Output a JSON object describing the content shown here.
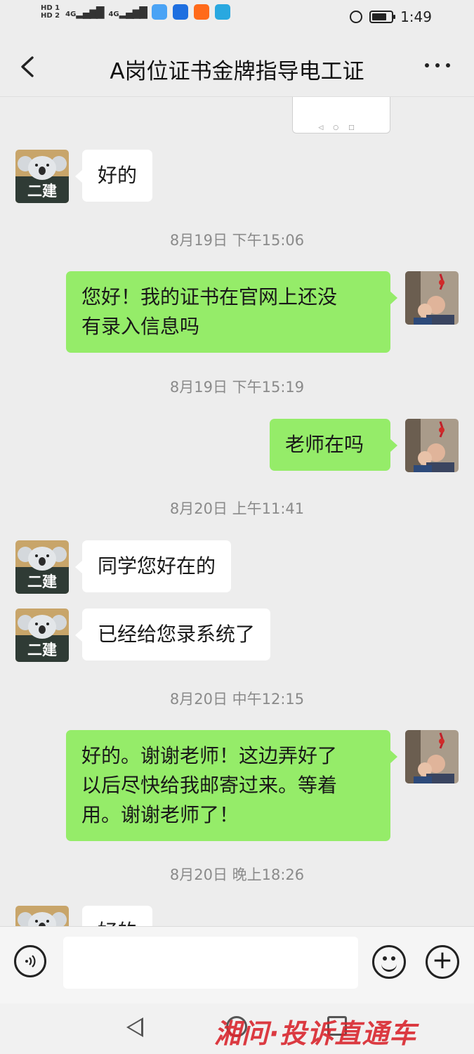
{
  "status_bar": {
    "hd1": "HD 1",
    "hd2": "HD 2",
    "signal1": "4G",
    "signal2": "4G",
    "time": "1:49"
  },
  "header": {
    "title": "A岗位证书金牌指导电工证"
  },
  "messages": [
    {
      "type": "text",
      "side": "left",
      "text": "好的"
    },
    {
      "type": "time",
      "text": "8月19日 下午15:06"
    },
    {
      "type": "text",
      "side": "right",
      "text": "您好！我的证书在官网上还没\n有录入信息吗"
    },
    {
      "type": "time",
      "text": "8月19日 下午15:19"
    },
    {
      "type": "text",
      "side": "right",
      "text": "老师在吗"
    },
    {
      "type": "time",
      "text": "8月20日 上午11:41"
    },
    {
      "type": "text",
      "side": "left",
      "text": "同学您好在的"
    },
    {
      "type": "text",
      "side": "left",
      "text": "已经给您录系统了"
    },
    {
      "type": "time",
      "text": "8月20日 中午12:15"
    },
    {
      "type": "text",
      "side": "right",
      "text": "好的。谢谢老师！这边弄好了\n以后尽快给我邮寄过来。等着\n用。谢谢老师了！"
    },
    {
      "type": "time",
      "text": "8月20日 晚上18:26"
    },
    {
      "type": "text",
      "side": "left",
      "text": "好的"
    }
  ],
  "teacher_avatar": {
    "label": "二建"
  },
  "input": {
    "value": ""
  },
  "watermark": {
    "text": "湘问·投诉直通车"
  },
  "colors": {
    "background": "#ededed",
    "self_bubble": "#95ec69",
    "other_bubble": "#ffffff",
    "watermark": "#d9272e"
  }
}
